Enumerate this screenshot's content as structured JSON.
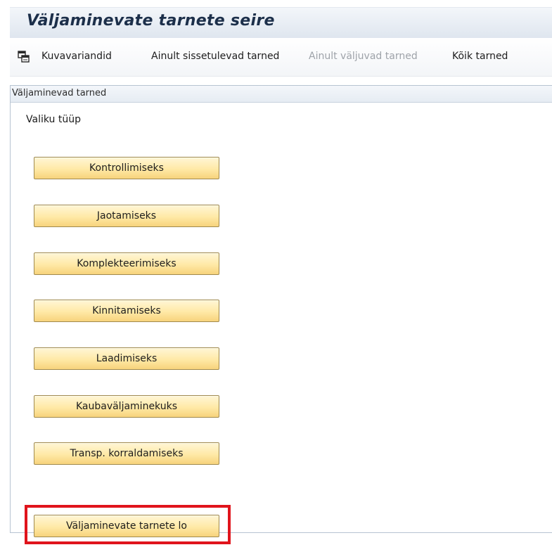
{
  "window": {
    "title": "Väljaminevate tarnete seire"
  },
  "toolbar": {
    "icon": "layout-variant-icon",
    "items": [
      {
        "label": "Kuvavariandid",
        "enabled": true
      },
      {
        "label": "Ainult sissetulevad tarned",
        "enabled": true
      },
      {
        "label": "Ainult väljuvad tarned",
        "enabled": false
      },
      {
        "label": "Kõik tarned",
        "enabled": true
      }
    ]
  },
  "panel": {
    "header": "Väljaminevad tarned",
    "section_label": "Valiku tüüp",
    "buttons": [
      {
        "label": "Kontrollimiseks"
      },
      {
        "label": "Jaotamiseks"
      },
      {
        "label": "Komplekteerimiseks"
      },
      {
        "label": "Kinnitamiseks"
      },
      {
        "label": "Laadimiseks"
      },
      {
        "label": "Kaubaväljaminekuks"
      },
      {
        "label": "Transp. korraldamiseks"
      },
      {
        "label": "Väljaminevate tarnete lo"
      }
    ]
  },
  "colors": {
    "button_fill": "#ffe9a6",
    "highlight": "#e0141c",
    "title_text": "#1c2f4a"
  }
}
